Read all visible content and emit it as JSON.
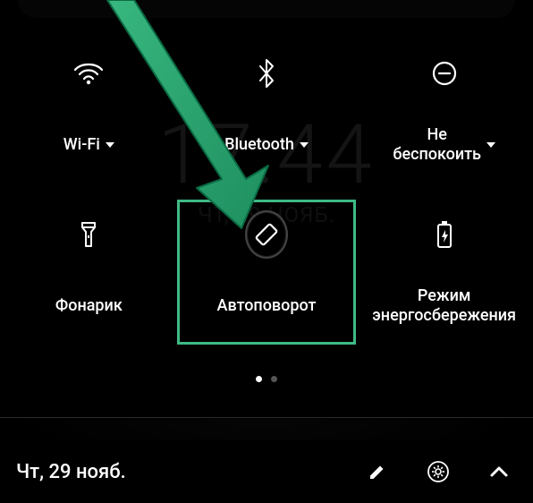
{
  "ghost": {
    "time": "17:44",
    "date_line": "чт, 29 нояб."
  },
  "tiles": [
    {
      "key": "wifi",
      "label": "Wi-Fi",
      "dropdown": true,
      "active": false
    },
    {
      "key": "bluetooth",
      "label": "Bluetooth",
      "dropdown": true,
      "active": false
    },
    {
      "key": "dnd",
      "label": "Не\nбеспокоить",
      "dropdown": true,
      "active": false
    },
    {
      "key": "flashlight",
      "label": "Фонарик",
      "dropdown": false,
      "active": false
    },
    {
      "key": "autorotate",
      "label": "Автоповорот",
      "dropdown": false,
      "active": false,
      "highlighted": true,
      "ringed": true
    },
    {
      "key": "battery",
      "label": "Режим\nэнергосбережения",
      "dropdown": false,
      "active": false
    }
  ],
  "pager": {
    "pages": 2,
    "current": 1
  },
  "bottom": {
    "date": "Чт, 29 нояб.",
    "icons": [
      "edit",
      "settings-user",
      "collapse"
    ]
  },
  "annotation_arrow_color": "#29a26f"
}
